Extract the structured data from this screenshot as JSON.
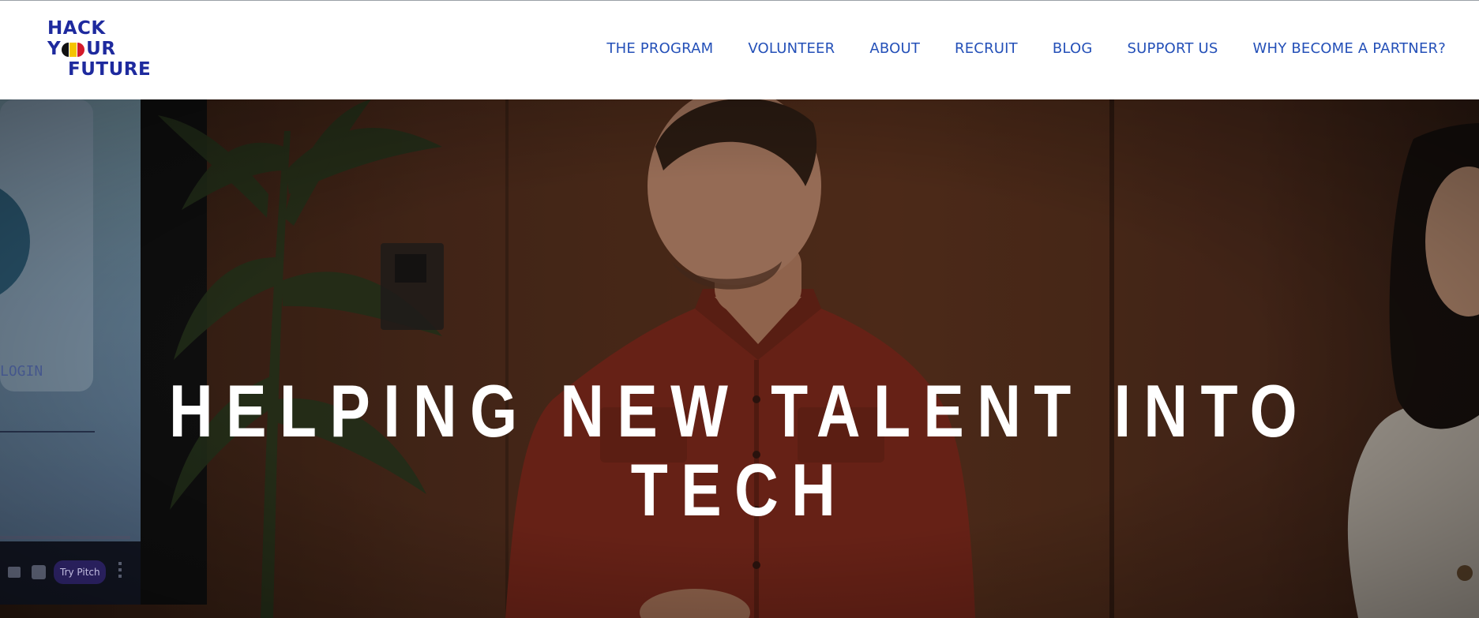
{
  "brand": {
    "line1": "HACK",
    "line2_pre": "Y",
    "line2_post": "UR",
    "line3": "FUTURE",
    "colors": {
      "text": "#1e2a9e",
      "flag": [
        "#111111",
        "#f5c400",
        "#d41a2a"
      ]
    }
  },
  "nav": {
    "items": [
      {
        "label": "THE PROGRAM"
      },
      {
        "label": "VOLUNTEER"
      },
      {
        "label": "ABOUT"
      },
      {
        "label": "RECRUIT"
      },
      {
        "label": "BLOG"
      },
      {
        "label": "SUPPORT US"
      },
      {
        "label": "WHY BECOME A PARTNER?"
      }
    ],
    "color": "#2450b8"
  },
  "hero": {
    "title": "HELPING NEW TALENT INTO TECH",
    "screen_text": "LOGIN",
    "screen_button": "Try Pitch"
  }
}
